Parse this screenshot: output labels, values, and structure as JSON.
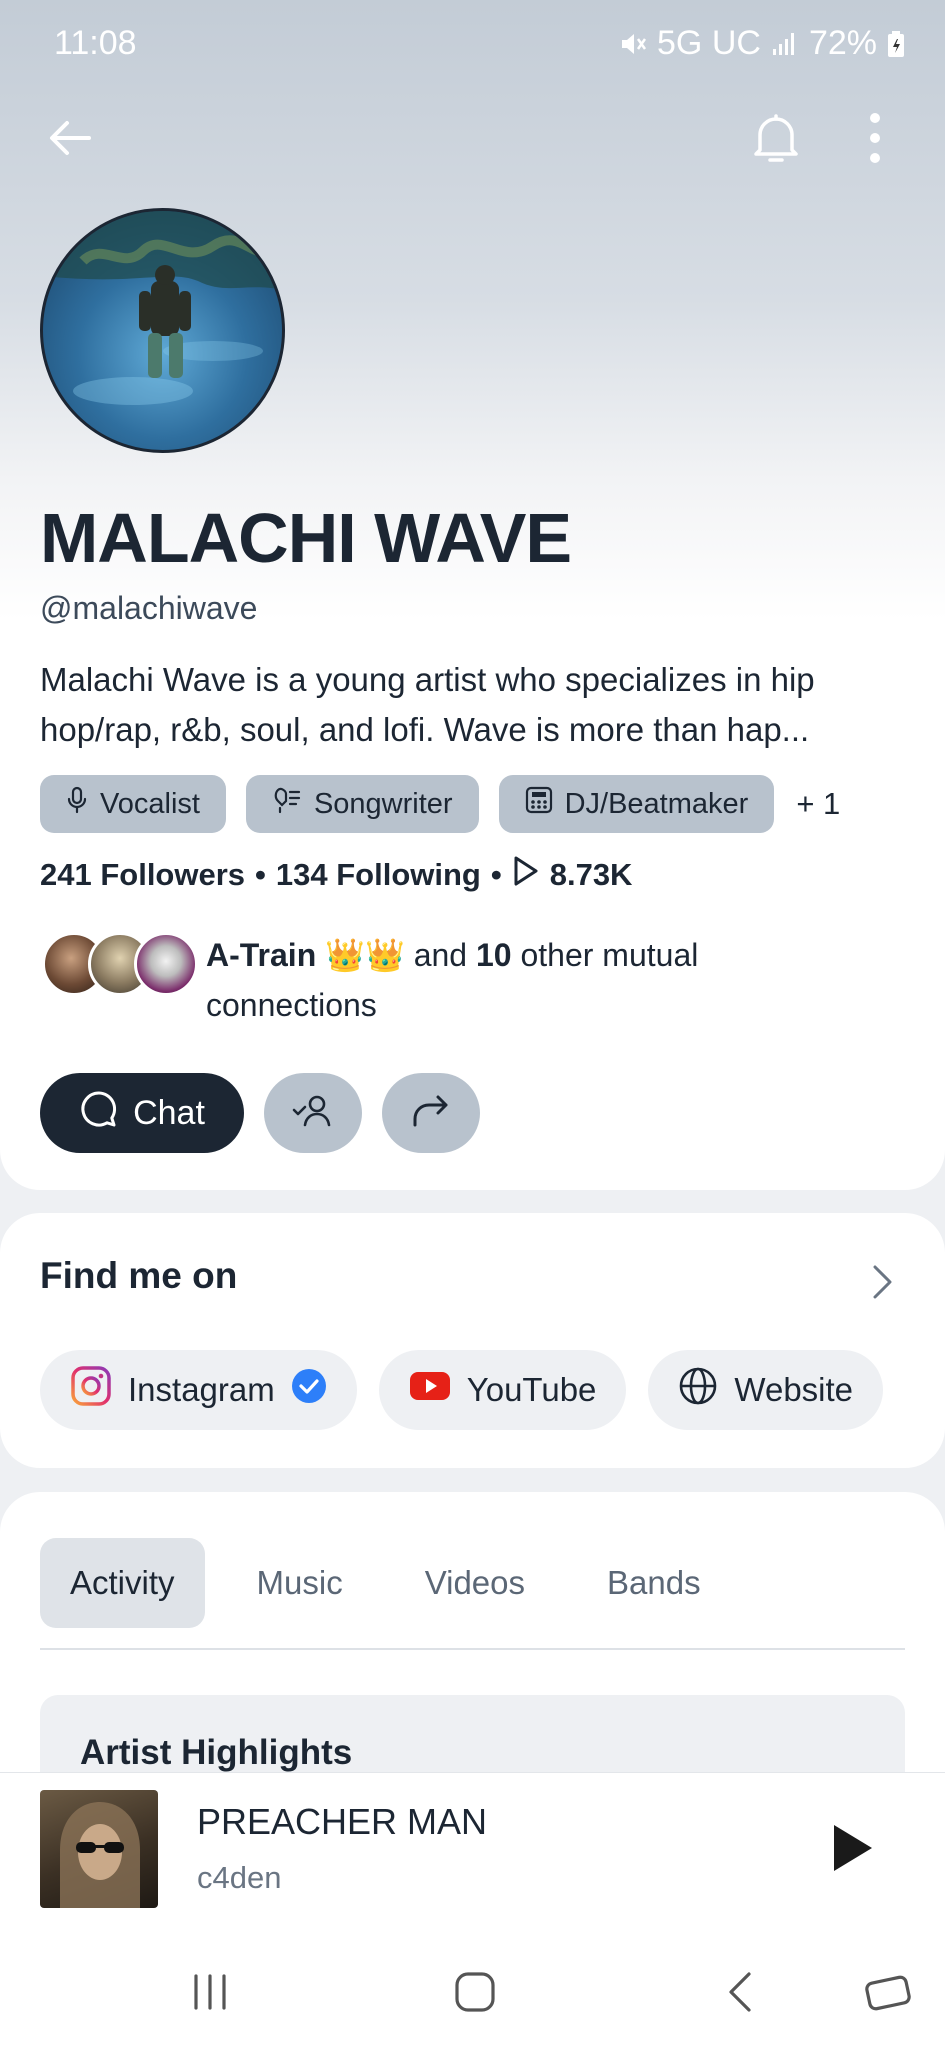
{
  "status_bar": {
    "time": "11:08",
    "network": "5G UC",
    "battery": "72%"
  },
  "profile": {
    "name": "MALACHI WAVE",
    "handle": "@malachiwave",
    "bio": "Malachi Wave is a young artist who specializes in hip hop/rap, r&b, soul, and lofi. Wave is more than hap...",
    "tags": [
      {
        "label": "Vocalist",
        "icon": "microphone-icon"
      },
      {
        "label": "Songwriter",
        "icon": "songwriter-icon"
      },
      {
        "label": "DJ/Beatmaker",
        "icon": "beatmaker-icon"
      }
    ],
    "tags_more": "+ 1",
    "stats": {
      "followers": "241 Followers",
      "following": "134 Following",
      "sep": "•",
      "plays": "8.73K"
    },
    "mutual": {
      "name": "A-Train",
      "emoji": "👑👑",
      "and": "and",
      "count": "10",
      "rest": "other mutual connections"
    },
    "actions": {
      "chat_label": "Chat"
    }
  },
  "find_me": {
    "title": "Find me on",
    "links": [
      {
        "label": "Instagram",
        "icon": "instagram-icon",
        "verified": true
      },
      {
        "label": "YouTube",
        "icon": "youtube-icon"
      },
      {
        "label": "Website",
        "icon": "globe-icon"
      }
    ]
  },
  "tabs": [
    {
      "label": "Activity",
      "active": true
    },
    {
      "label": "Music"
    },
    {
      "label": "Videos"
    },
    {
      "label": "Bands"
    }
  ],
  "highlights": {
    "title": "Artist Highlights"
  },
  "player": {
    "title": "PREACHER MAN",
    "artist": "c4den"
  },
  "colors": {
    "dark": "#1c2633",
    "chip": "#b8c2cd",
    "youtube": "#e62117",
    "verified": "#2d7ff9"
  }
}
